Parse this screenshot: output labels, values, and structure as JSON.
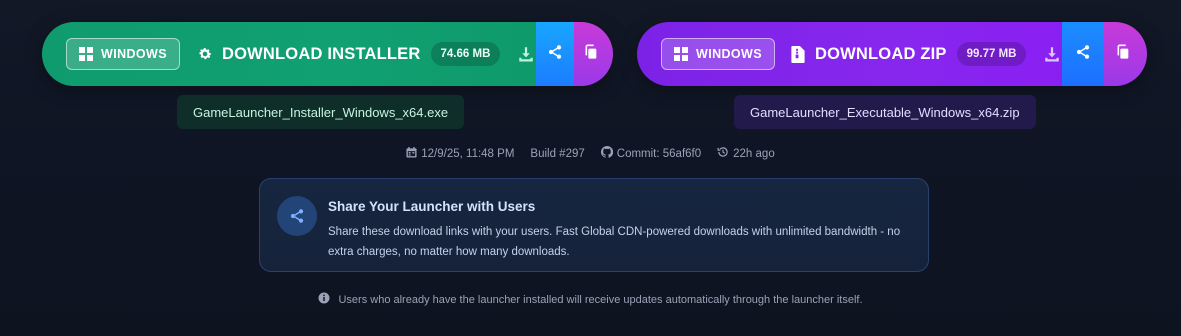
{
  "installer": {
    "platform_label": "WINDOWS",
    "main_label": "DOWNLOAD INSTALLER",
    "size": "74.66 MB",
    "filename": "GameLauncher_Installer_Windows_x64.exe",
    "icon": "gear-icon"
  },
  "zip": {
    "platform_label": "WINDOWS",
    "main_label": "DOWNLOAD ZIP",
    "size": "99.77 MB",
    "filename": "GameLauncher_Executable_Windows_x64.zip",
    "icon": "zip-file-icon"
  },
  "meta": {
    "date": "12/9/25, 11:48 PM",
    "build": "Build #297",
    "commit": "Commit: 56af6f0",
    "age": "22h ago"
  },
  "share_card": {
    "title": "Share Your Launcher with Users",
    "body": "Share these download links with your users. Fast Global CDN-powered downloads with unlimited bandwidth - no extra charges, no matter how many downloads."
  },
  "footer_note": "Users who already have the launcher installed will receive updates automatically through the launcher itself.",
  "colors": {
    "installer_accent": "#10a072",
    "zip_accent": "#8727ee",
    "share_accent": "#1c7cff",
    "copy_accent": "#b83ae0",
    "background": "#111827"
  }
}
